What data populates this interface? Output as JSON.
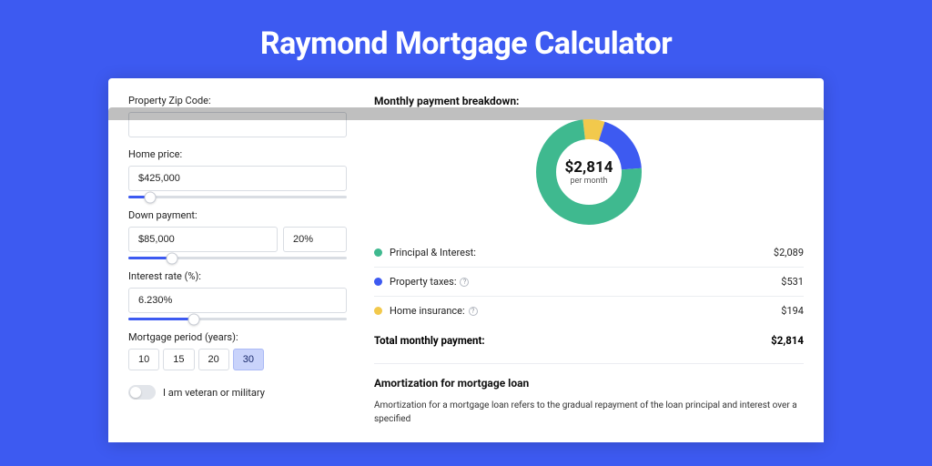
{
  "colors": {
    "accent": "#3d5af1",
    "principal": "#3fb98f",
    "taxes": "#3d5af1",
    "insurance": "#f2c94c"
  },
  "title": "Raymond Mortgage Calculator",
  "form": {
    "zip_label": "Property Zip Code:",
    "zip_value": "",
    "home_price_label": "Home price:",
    "home_price_value": "$425,000",
    "home_price_slider_pct": 10,
    "down_payment_label": "Down payment:",
    "down_payment_value": "$85,000",
    "down_payment_pct_value": "20%",
    "down_payment_slider_pct": 20,
    "interest_label": "Interest rate (%):",
    "interest_value": "6.230%",
    "interest_slider_pct": 30,
    "period_label": "Mortgage period (years):",
    "period_options": [
      "10",
      "15",
      "20",
      "30"
    ],
    "period_selected": "30",
    "veteran_label": "I am veteran or military",
    "veteran_on": false
  },
  "breakdown": {
    "title": "Monthly payment breakdown:",
    "center_value": "$2,814",
    "center_sub": "per month",
    "items": [
      {
        "key": "principal",
        "label": "Principal & Interest:",
        "value": "$2,089",
        "info": false
      },
      {
        "key": "taxes",
        "label": "Property taxes:",
        "value": "$531",
        "info": true
      },
      {
        "key": "insurance",
        "label": "Home insurance:",
        "value": "$194",
        "info": true
      }
    ],
    "total_label": "Total monthly payment:",
    "total_value": "$2,814"
  },
  "amort": {
    "title": "Amortization for mortgage loan",
    "text": "Amortization for a mortgage loan refers to the gradual repayment of the loan principal and interest over a specified"
  },
  "chart_data": {
    "type": "pie",
    "title": "Monthly payment breakdown",
    "series": [
      {
        "name": "Principal & Interest",
        "value": 2089,
        "color": "#3fb98f"
      },
      {
        "name": "Property taxes",
        "value": 531,
        "color": "#3d5af1"
      },
      {
        "name": "Home insurance",
        "value": 194,
        "color": "#f2c94c"
      }
    ],
    "total": 2814,
    "center_label": "$2,814 per month"
  }
}
